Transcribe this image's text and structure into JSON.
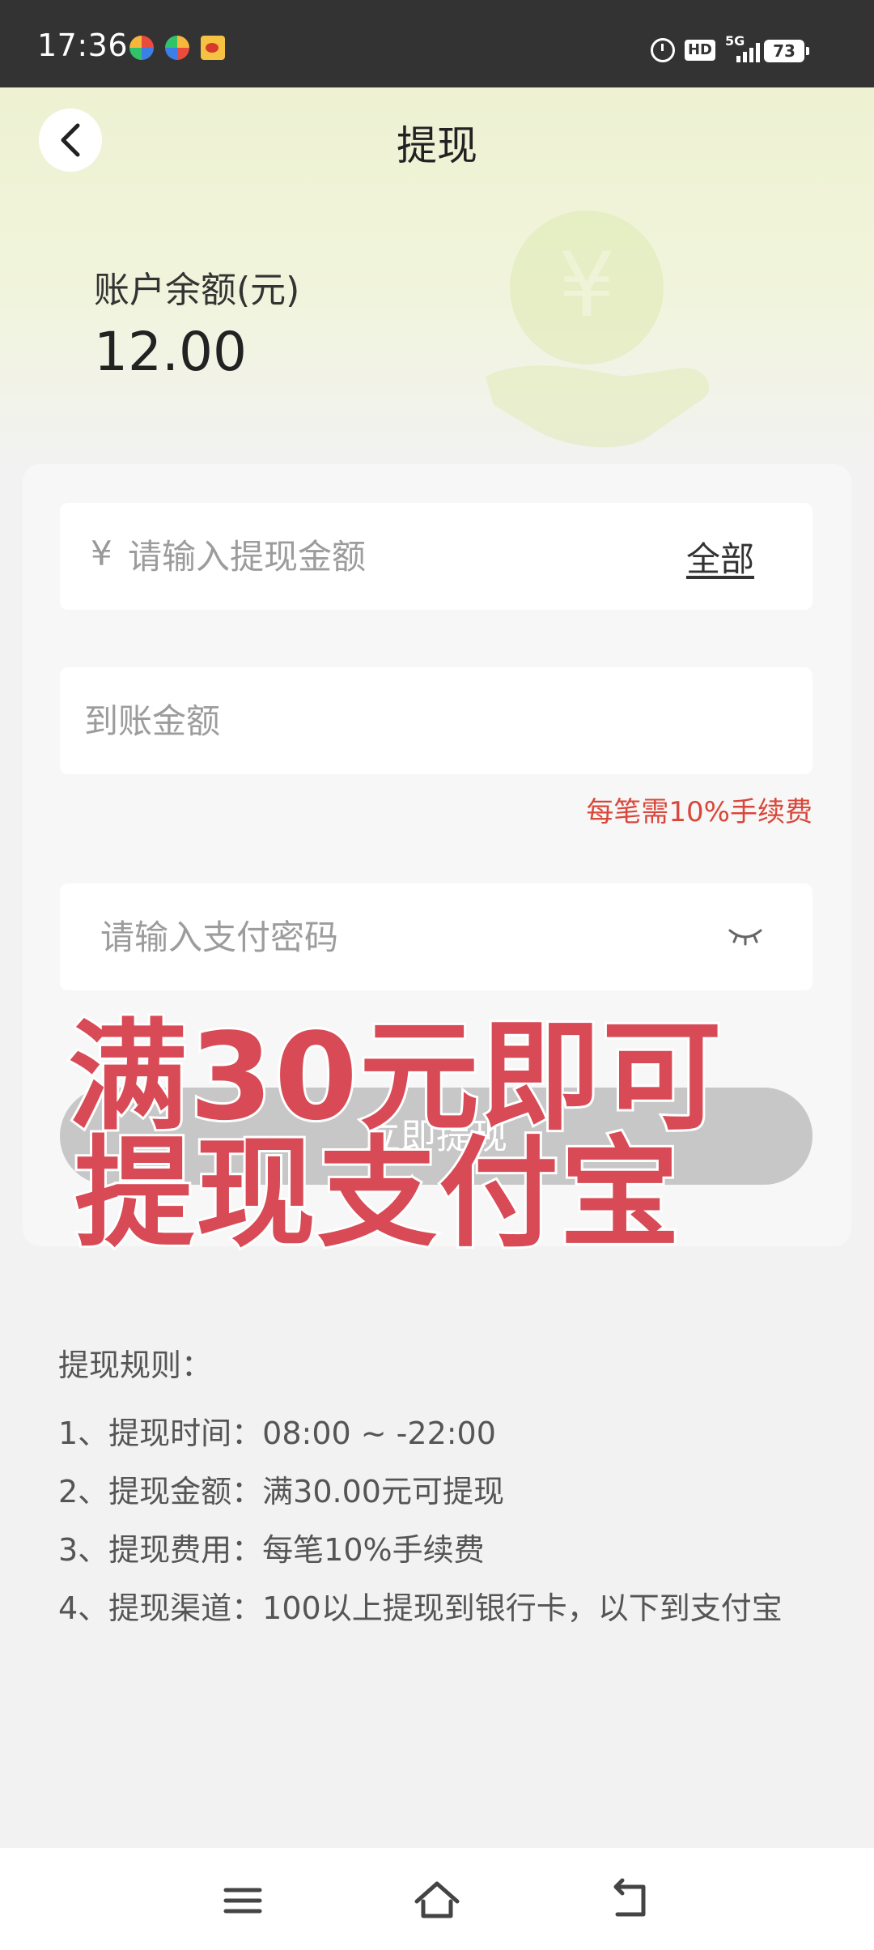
{
  "status_bar": {
    "time": "17:36",
    "hd_label": "HD",
    "network": "5G",
    "battery": "73"
  },
  "header": {
    "title": "提现",
    "back_icon": "chevron-left-icon"
  },
  "balance": {
    "label": "账户余额(元)",
    "value": "12.00"
  },
  "form": {
    "currency_symbol": "¥",
    "amount_placeholder": "请输入提现金额",
    "all_link": "全部",
    "received_placeholder": "到账金额",
    "fee_note": "每笔需10%手续费",
    "password_placeholder": "请输入支付密码",
    "eye_icon": "eye-closed-icon",
    "submit_label": "立即提现"
  },
  "promo": {
    "line1": "满30元即可",
    "line2": "提现支付宝"
  },
  "rules": {
    "title": "提现规则：",
    "items": [
      "1、提现时间：08:00 ~ -22:00",
      "2、提现金额：满30.00元可提现",
      "3、提现费用：每笔10%手续费",
      "4、提现渠道：100以上提现到银行卡，以下到支付宝"
    ]
  },
  "colors": {
    "accent_red": "#d9473a",
    "promo_red": "#d84a55",
    "button_disabled": "#c7c7c7",
    "hero_tint": "#eef2d2"
  }
}
